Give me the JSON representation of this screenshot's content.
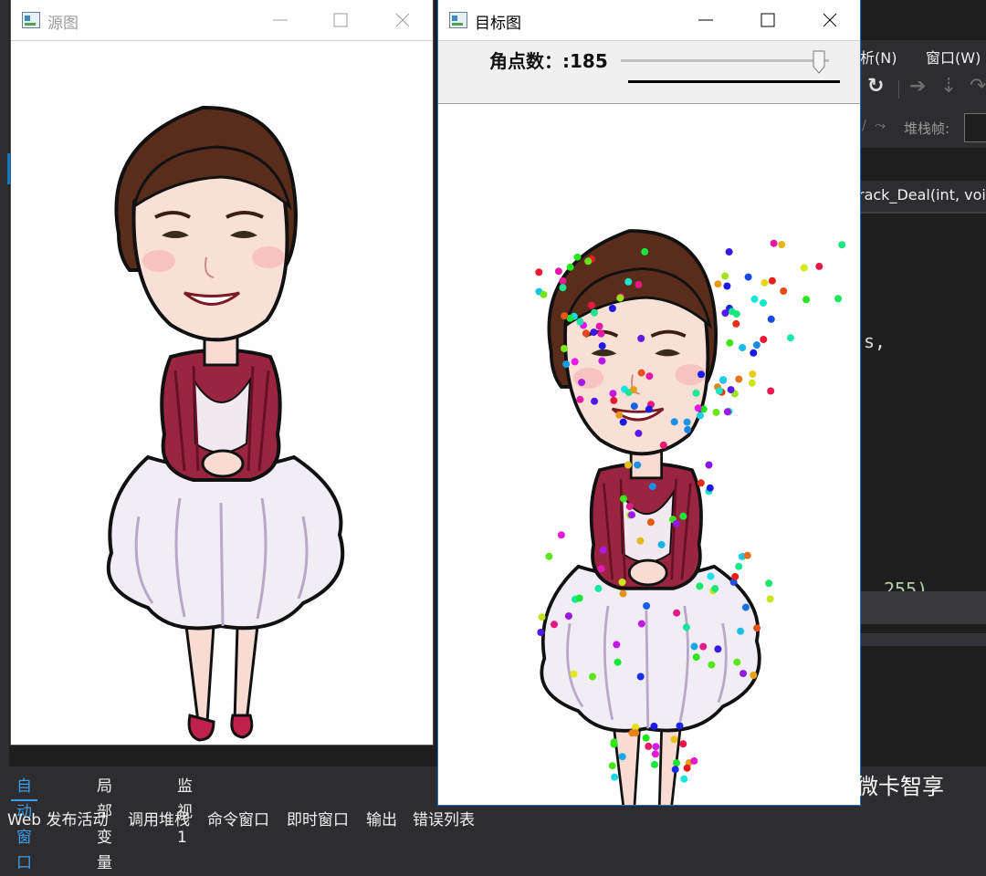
{
  "ide": {
    "menu": [
      "析(N)",
      "窗口(W)"
    ],
    "stack_frame_label": "堆栈帧:",
    "doc_tab": "rack_Deal(int, voi",
    "code_fragments": [
      "s,",
      "255)"
    ],
    "watch_tabs": [
      "自动窗口",
      "局部变量",
      "监视 1"
    ],
    "output_tabs": [
      "Web 发布活动",
      "调用堆栈",
      "命令窗口",
      "即时窗口",
      "输出",
      "错误列表"
    ]
  },
  "source_window": {
    "title": "源图"
  },
  "target_window": {
    "title": "目标图",
    "trackbar_label": "角点数：",
    "trackbar_value": ":185",
    "trackbar_fraction": 0.95,
    "corner_count": 185
  },
  "watermark": {
    "text": "微卡智享",
    "icon": "wechat-icon"
  },
  "colors": {
    "ide_bg": "#1e1e1e",
    "ide_chrome": "#2d2d30",
    "accent": "#007acc",
    "dress_red": "#9a2540",
    "hair": "#5a2c1c"
  }
}
